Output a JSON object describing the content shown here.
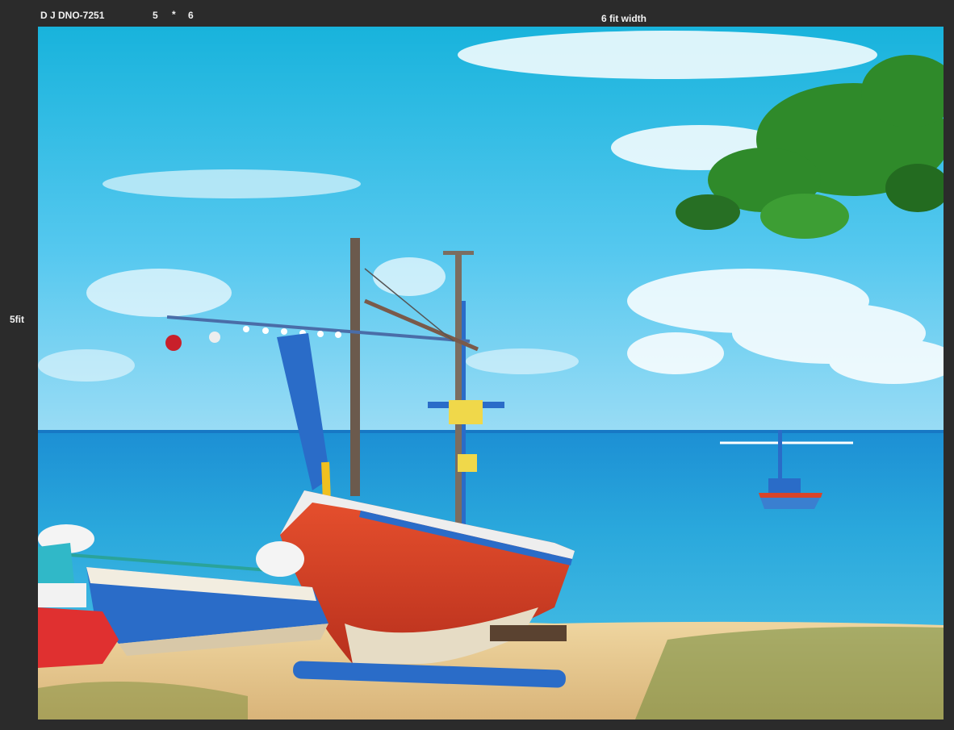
{
  "header": {
    "code": "D J DNO-7251",
    "dim_width": "5",
    "dim_separator": "*",
    "dim_height": "6",
    "width_label": "6 fit width"
  },
  "side": {
    "height_label": "5fit"
  },
  "photo": {
    "subject": "beach-with-fishing-boats",
    "colors": {
      "sky_top": "#19b6dd",
      "sky_bottom": "#7fd6f2",
      "sea": "#2aa8dc",
      "sand": "#e8c98d",
      "boat_red": "#d8442a",
      "boat_blue": "#2a6cc8",
      "leaves": "#2f8a2a"
    }
  }
}
